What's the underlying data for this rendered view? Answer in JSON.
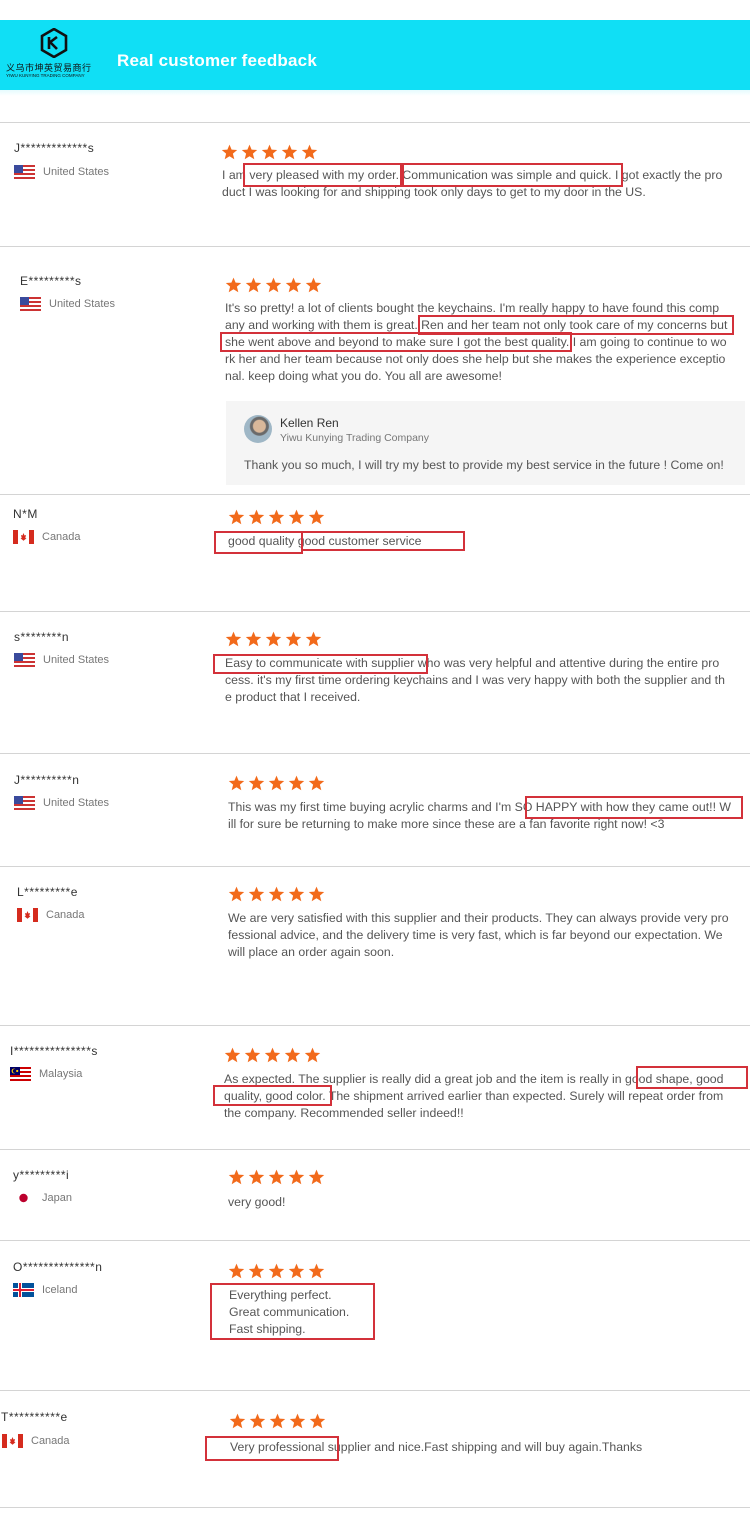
{
  "header": {
    "title": "Real customer feedback",
    "logo_cn": "义乌市坤英贸易商行",
    "logo_en": "YIWU KUNYING TRADING COMPANY"
  },
  "colors": {
    "header_bg": "#10dff5",
    "star": "#f26a1b",
    "highlight_box": "#d3313a"
  },
  "reviews": [
    {
      "name": "J*************s",
      "country": "United States",
      "flag": "us-flag",
      "rating": 5,
      "text": "I am very pleased with my order. Communication was simple and quick.  I got exactly the pro\nduct I was looking for and shipping took only days to get to my door in the US."
    },
    {
      "name": "E*********s",
      "country": "United States",
      "flag": "us-flag",
      "rating": 5,
      "text": "It's so pretty! a lot of clients bought the keychains. I'm really happy to have found this comp\nany and working with them is great. Ren and her team not only took care of my concerns but\nshe went above and beyond to make sure I got the best quality. I am going to continue to wo\nrk her and her team because not only does she help but she makes the experience exceptio\nnal. keep doing what you do. You all are awesome!",
      "reply": {
        "name": "Kellen Ren",
        "company": "Yiwu Kunying Trading Company",
        "text": "Thank you so much, I will try my best to provide my best service in the future ! Come on!"
      }
    },
    {
      "name": "N*M",
      "country": "Canada",
      "flag": "canada-flag",
      "rating": 5,
      "text": "good quality good customer service"
    },
    {
      "name": "s********n",
      "country": "United States",
      "flag": "us-flag",
      "rating": 5,
      "text": "Easy to communicate with supplier who was very helpful and attentive during the entire pro\ncess. it's my first time ordering keychains and I was very happy with both the supplier and th\ne product that I received."
    },
    {
      "name": "J**********n",
      "country": "United States",
      "flag": "us-flag",
      "rating": 5,
      "text": "This was my first time buying acrylic charms and I'm SO HAPPY with how they came out!! W\nill for sure be returning to make more since these are a fan favorite right now! <3"
    },
    {
      "name": "L*********e",
      "country": "Canada",
      "flag": "canada-flag",
      "rating": 5,
      "text": "We are very satisfied with this supplier and their products. They can always provide very pro\nfessional advice, and the delivery time is very fast, which is far beyond our expectation. We\nwill place an order again soon."
    },
    {
      "name": "I***************s",
      "country": "Malaysia",
      "flag": "malaysia-flag",
      "rating": 5,
      "text": "As expected. The supplier is really did a great job and the item is really in good shape, good\nquality, good color. The shipment arrived earlier than expected. Surely will repeat order from\nthe company. Recommended seller indeed!!"
    },
    {
      "name": "y*********i",
      "country": "Japan",
      "flag": "japan-flag",
      "rating": 5,
      "text": "very good!"
    },
    {
      "name": "O**************n",
      "country": "Iceland",
      "flag": "iceland-flag",
      "rating": 5,
      "text": "Everything perfect.\nGreat communication.\nFast shipping."
    },
    {
      "name": "T**********e",
      "country": "Canada",
      "flag": "canada-flag",
      "rating": 5,
      "text": "Very professional supplier and nice.Fast shipping and will buy again.Thanks"
    }
  ]
}
